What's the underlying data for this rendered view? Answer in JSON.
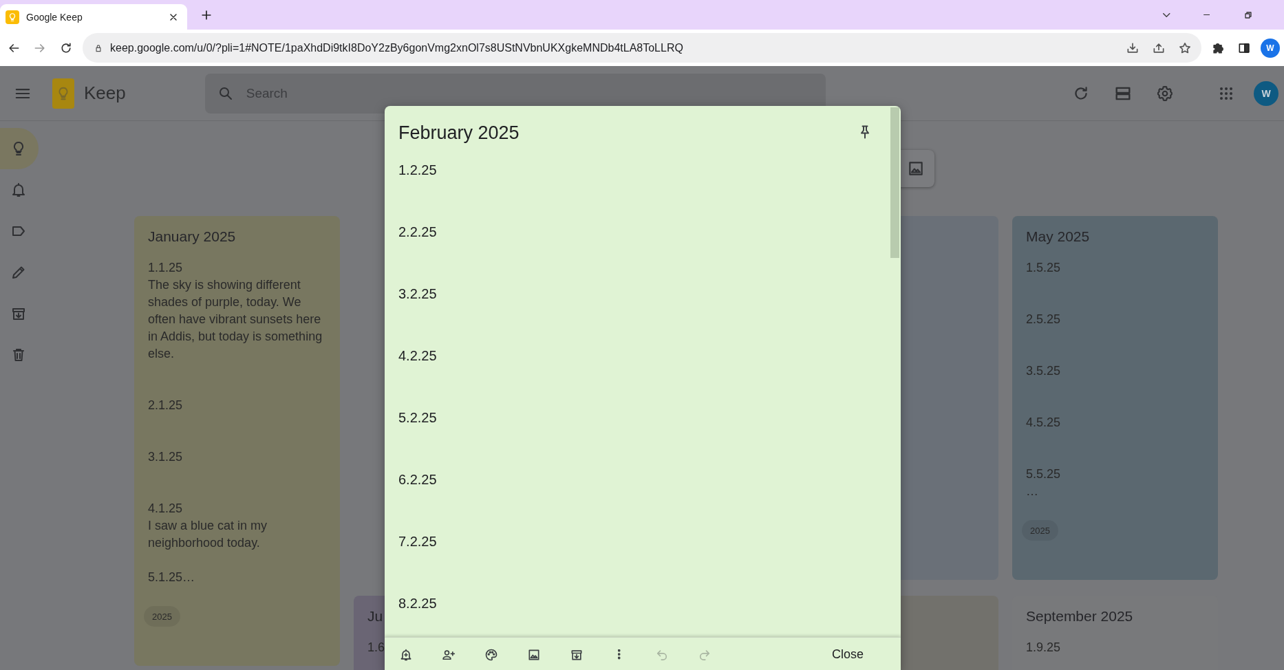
{
  "browser": {
    "tab_title": "Google Keep",
    "url": "keep.google.com/u/0/?pli=1#NOTE/1paXhdDi9tkI8DoY2zBy6gonVmg2xnOl7s8UStNVbnUKXgkeMNDb4tLA8ToLLRQ",
    "profile_initial": "W"
  },
  "header": {
    "app_name": "Keep",
    "search": {
      "placeholder": "Search"
    },
    "account_initial": "W"
  },
  "sidebar": {
    "items": [
      {
        "kind": "notes",
        "selected": true
      },
      {
        "kind": "reminders",
        "selected": false
      },
      {
        "kind": "labels",
        "selected": false
      },
      {
        "kind": "edit",
        "selected": false
      },
      {
        "kind": "archive",
        "selected": false
      },
      {
        "kind": "trash",
        "selected": false
      }
    ]
  },
  "notes": [
    {
      "title": "January 2025",
      "body": "1.1.25\nThe sky is showing different shades of purple, today. We often have vibrant sunsets here in Addis, but today is something else.\n\n\n2.1.25\n\n\n3.1.25\n\n\n4.1.25\nI saw a blue cat in my neighborhood today.\n\n5.1.25…",
      "label": "2025",
      "color": "#787760"
    },
    {
      "title": "Ju",
      "body": "1.6",
      "color": "#6a6574"
    },
    {
      "color": "#6a7078"
    },
    {
      "title": "May 2025",
      "body": "1.5.25\n\n\n2.5.25\n\n\n3.5.25\n\n\n4.5.25\n\n\n5.5.25\n…",
      "label": "2025",
      "color": "#5b6870"
    },
    {
      "color": "#72716c"
    },
    {
      "title": "September 2025",
      "body": "1.9.25",
      "color": "#78797b"
    }
  ],
  "dialog": {
    "title": "February 2025",
    "body": "1.2.25\n\n\n2.2.25\n\n\n3.2.25\n\n\n4.2.25\n\n\n5.2.25\n\n\n6.2.25\n\n\n7.2.25\n\n\n8.2.25",
    "toolbar": [
      {
        "kind": "remind",
        "disabled": false
      },
      {
        "kind": "collaborator",
        "disabled": false
      },
      {
        "kind": "palette",
        "disabled": false
      },
      {
        "kind": "image",
        "disabled": false
      },
      {
        "kind": "archive",
        "disabled": false
      },
      {
        "kind": "more",
        "disabled": false
      },
      {
        "kind": "undo",
        "disabled": true
      },
      {
        "kind": "redo",
        "disabled": true
      }
    ],
    "close_label": "Close"
  }
}
